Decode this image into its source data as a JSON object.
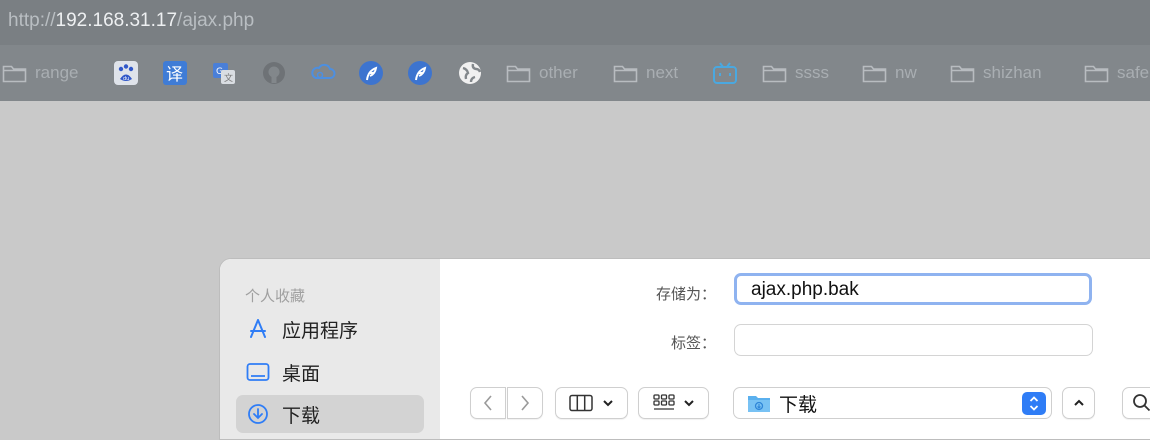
{
  "browser": {
    "url_scheme": "http://",
    "url_host": "192.168.31.17",
    "url_path": "/ajax.php"
  },
  "bookmarks": [
    {
      "label": "range",
      "icon": "folder-icon"
    },
    {
      "label": "",
      "icon": "baidu-icon"
    },
    {
      "label": "",
      "icon": "translate-icon"
    },
    {
      "label": "",
      "icon": "google-translate-icon"
    },
    {
      "label": "",
      "icon": "github-icon"
    },
    {
      "label": "",
      "icon": "cloud-icon"
    },
    {
      "label": "",
      "icon": "feather-icon"
    },
    {
      "label": "",
      "icon": "feather-icon"
    },
    {
      "label": "",
      "icon": "globe-icon"
    },
    {
      "label": "other",
      "icon": "folder-icon"
    },
    {
      "label": "next",
      "icon": "folder-icon"
    },
    {
      "label": "",
      "icon": "bilibili-icon"
    },
    {
      "label": "ssss",
      "icon": "folder-icon"
    },
    {
      "label": "nw",
      "icon": "folder-icon"
    },
    {
      "label": "shizhan",
      "icon": "folder-icon"
    },
    {
      "label": "safe",
      "icon": "folder-icon"
    }
  ],
  "dialog": {
    "sidebar": {
      "heading": "个人收藏",
      "items": [
        {
          "label": "应用程序",
          "icon": "applications-icon"
        },
        {
          "label": "桌面",
          "icon": "desktop-icon"
        },
        {
          "label": "下载",
          "icon": "download-icon",
          "selected": true
        }
      ]
    },
    "save_as_label": "存储为：",
    "save_as_value": "ajax.php.bak",
    "tags_label": "标签：",
    "tags_value": "",
    "location": "下载",
    "accent_color": "#2f7df6"
  }
}
